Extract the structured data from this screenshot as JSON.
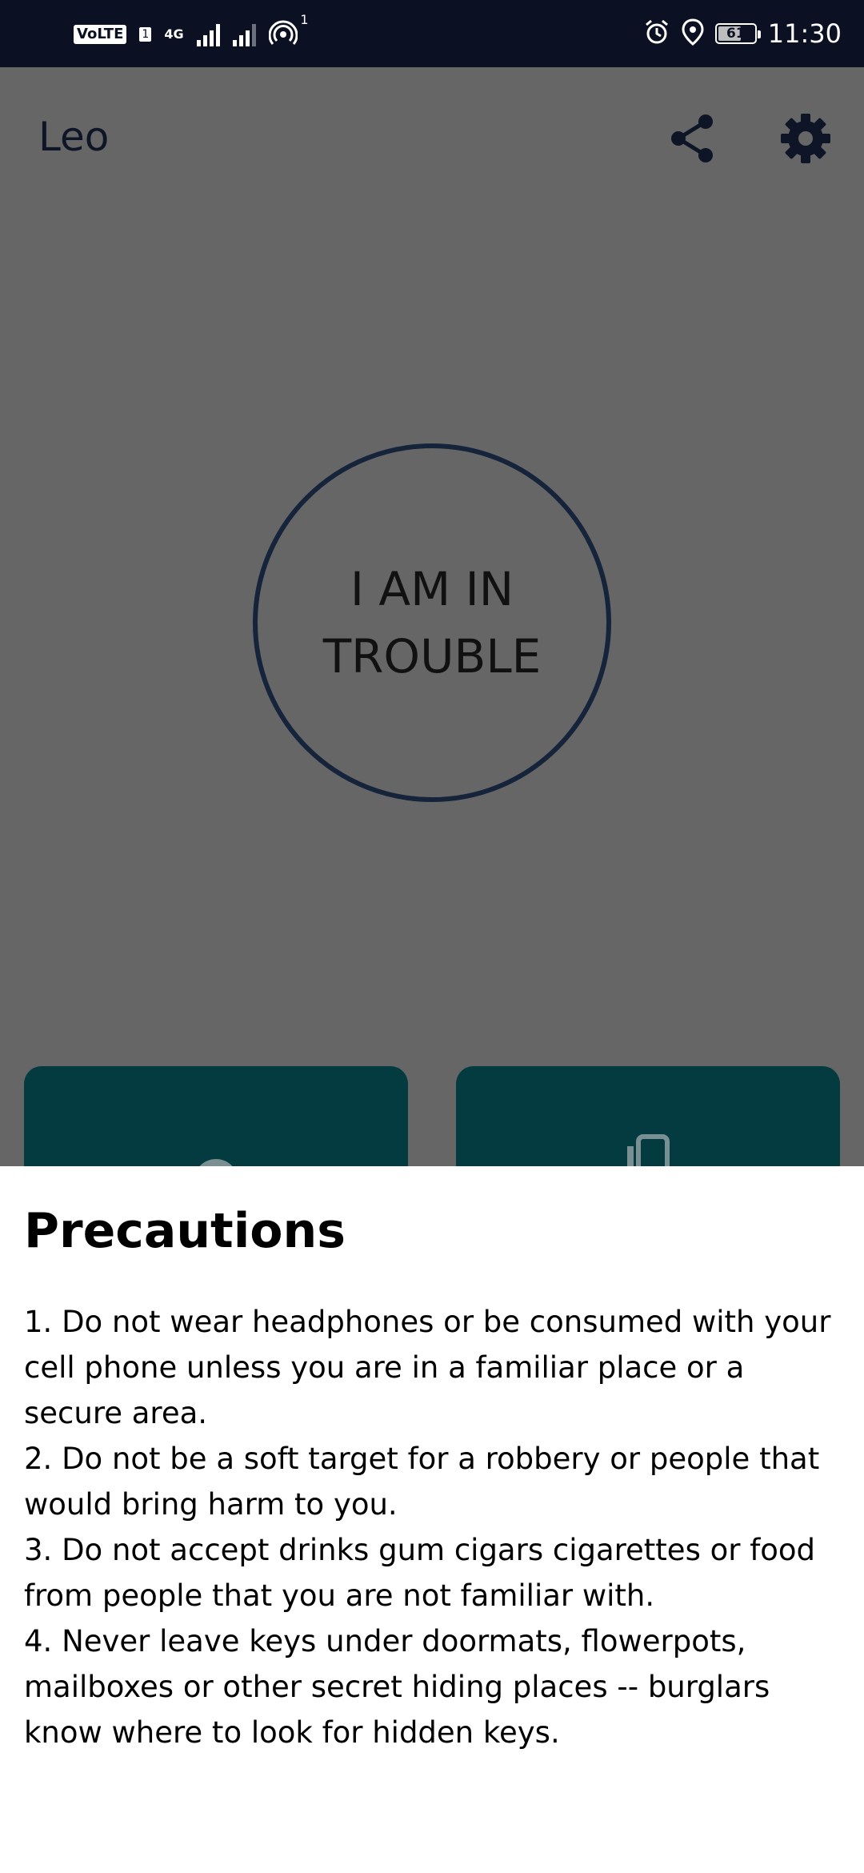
{
  "status_bar": {
    "volte": "VoLTE",
    "sim_slot": "1",
    "network_type": "4G",
    "hotspot_count": "1",
    "battery_level": "61",
    "time": "11:30",
    "icons": [
      "signal-icon",
      "hotspot-icon",
      "alarm-icon",
      "location-icon",
      "battery-icon"
    ]
  },
  "app_bar": {
    "title": "Leo",
    "actions": [
      "share-icon",
      "settings-icon"
    ]
  },
  "main": {
    "trouble_button_label": "I AM IN TROUBLE"
  },
  "colors": {
    "status_bar_bg": "#0b1122",
    "scrim_bg": "#666666",
    "card_bg": "#033b40",
    "circle_border": "#15243a",
    "sheet_bg": "#ffffff"
  },
  "sheet": {
    "title": "Precautions",
    "items": [
      "1. Do not wear headphones or be consumed with your cell phone unless you are in a familiar place or a secure area.",
      "2. Do not be a soft target for a robbery or people that would bring harm to you.",
      "3. Do not accept drinks gum cigars cigarettes or food from people that you are not familiar with.",
      "4. Never leave keys under doormats, flowerpots, mailboxes or other secret hiding places -- burglars know where to look for hidden keys."
    ]
  }
}
